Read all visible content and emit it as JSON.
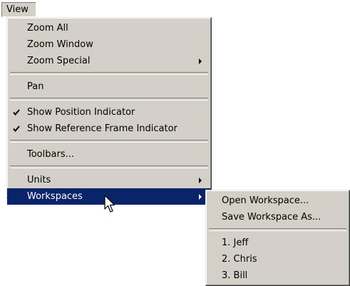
{
  "menubar": {
    "view_label": "View"
  },
  "view_menu": {
    "items": [
      {
        "label": "Zoom All"
      },
      {
        "label": "Zoom Window"
      },
      {
        "label": "Zoom Special"
      },
      {
        "label": "Pan"
      },
      {
        "label": "Show Position Indicator",
        "checked": true
      },
      {
        "label": "Show Reference Frame Indicator",
        "checked": true
      },
      {
        "label": "Toolbars..."
      },
      {
        "label": "Units"
      },
      {
        "label": "Workspaces",
        "highlighted": true
      }
    ]
  },
  "workspaces_submenu": {
    "items": [
      {
        "label": "Open Workspace..."
      },
      {
        "label": "Save Workspace As..."
      },
      {
        "label": "1. Jeff"
      },
      {
        "label": "2. Chris"
      },
      {
        "label": "3. Bill"
      }
    ]
  },
  "colors": {
    "menu_bg": "#d4d0c8",
    "highlight": "#0a246a",
    "highlight_text": "#ffffff"
  },
  "icons": {
    "check": "checkmark-icon",
    "submenu_arrow": "chevron-right-icon",
    "cursor": "mouse-pointer-icon"
  }
}
